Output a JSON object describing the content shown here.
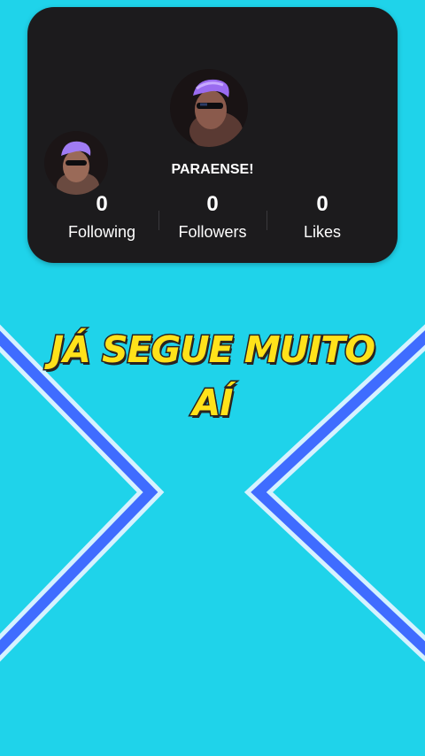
{
  "profile": {
    "username": "PARAENSE!",
    "main_avatar": "profile-avatar",
    "secondary_avatar": "profile-avatar-small"
  },
  "stats": {
    "following": {
      "value": "0",
      "label": "Following"
    },
    "followers": {
      "value": "0",
      "label": "Followers"
    },
    "likes": {
      "value": "0",
      "label": "Likes"
    }
  },
  "caption": {
    "line1": "JÁ SEGUE MUITO",
    "line2": "AÍ"
  },
  "colors": {
    "background": "#1fd3ea",
    "card": "#1c1b1d",
    "caption_fill": "#ffe21a",
    "caption_stroke": "#2a2320",
    "chevron": "#3f6cff"
  }
}
